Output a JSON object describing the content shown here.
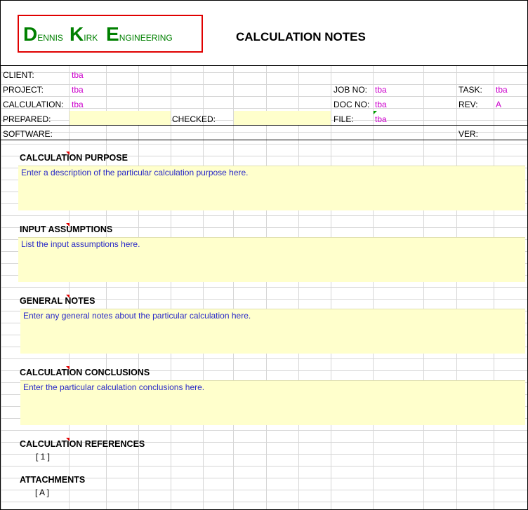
{
  "logo": {
    "word1_initial": "D",
    "word1_rest": "ENNIS",
    "word2_initial": "K",
    "word2_rest": "IRK",
    "word3_initial": "E",
    "word3_rest": "NGINEERING"
  },
  "title": "CALCULATION NOTES",
  "fields": {
    "client_label": "CLIENT:",
    "client_value": "tba",
    "project_label": "PROJECT:",
    "project_value": "tba",
    "calculation_label": "CALCULATION:",
    "calculation_value": "tba",
    "prepared_label": "PREPARED:",
    "checked_label": "CHECKED:",
    "software_label": "SOFTWARE:",
    "job_no_label": "JOB NO:",
    "job_no_value": "tba",
    "doc_no_label": "DOC NO:",
    "doc_no_value": "tba",
    "file_label": "FILE:",
    "file_value": "tba",
    "task_label": "TASK:",
    "task_value": "tba",
    "rev_label": "REV:",
    "rev_value": "A",
    "ver_label": "VER:"
  },
  "sections": [
    {
      "heading": "CALCULATION PURPOSE",
      "text": "Enter a description of the particular calculation purpose here."
    },
    {
      "heading": "INPUT ASSUMPTIONS",
      "text": "List the input assumptions here."
    },
    {
      "heading": "GENERAL NOTES",
      "text": "Enter any general notes about the particular calculation here."
    },
    {
      "heading": "CALCULATION CONCLUSIONS",
      "text": "Enter the particular calculation conclusions here."
    }
  ],
  "references": {
    "heading": "CALCULATION REFERENCES",
    "item": "[ 1 ]"
  },
  "attachments": {
    "heading": "ATTACHMENTS",
    "item": "[ A ]"
  },
  "colors": {
    "accent_green": "#008000",
    "value_magenta": "#cc00cc",
    "note_blue": "#2a2ac8",
    "cell_yellow": "#ffffcc",
    "logo_border": "#e00000"
  }
}
